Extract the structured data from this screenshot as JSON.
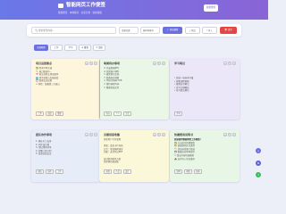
{
  "header": {
    "title": "智能网页工作便签",
    "subtitle": "拖拽便签 · 本地保存 · 标签分类 · 快捷编辑",
    "action_label": "新建便签"
  },
  "toolbar": {
    "search_placeholder": "🔍 搜索便签内容...",
    "category_select": "全部分类",
    "sort_select": "按时间排序",
    "add_label": "＋ 添加便签",
    "export_label": "⤓ 导出",
    "import_label": "⤒ 导入",
    "clear_label": "🗑 清空"
  },
  "tabs": [
    {
      "label": "全部便签",
      "active": true
    },
    {
      "label": "工作",
      "active": false
    },
    {
      "label": "学习",
      "active": false
    },
    {
      "label": "★ 重要",
      "active": false
    },
    {
      "label": "✎ 草稿",
      "active": false
    }
  ],
  "cards": [
    {
      "title": "项目进度要点",
      "color": "#fef6dc",
      "lines": [
        "✅ 需求评审完成",
        "🔧 接口联调中…",
        "📅 周五前提交测试版本",
        "👥 同步前端与后端进度",
        "🗂 整理会议纪要",
        "⚠ 风险：依赖第三方接口"
      ],
      "tags": [
        "工作",
        "进度",
        "重要"
      ]
    },
    {
      "title": "每周待办事项",
      "color": "#eaf6e6",
      "lines": [
        "☑ 完成周报撰写",
        "☑ 回复客户邮件",
        "☐ 更新项目文档",
        "☐ 准备周会材料",
        "☐ 代码评审两个PR",
        "☐ 预约体检时间",
        "☐ 整理桌面文件"
      ],
      "tags": [
        "待办",
        "个人",
        "生活"
      ]
    },
    {
      "title": "学习笔记",
      "color": "#ece7f8",
      "lines": [
        "• 阅读一章技术书籍",
        "• 观看课程视频",
        "• 整理读书笔记",
        "• 复习关键概念",
        "• 练习算法题目"
      ],
      "tags": [
        "学习"
      ]
    },
    {
      "title": "团队协作事项",
      "color": "#e6edf8",
      "lines": [
        "1. 确认分工安排",
        "2. 同步设计稿",
        "3. 测试用例评审",
        "4. 部署上线计划",
        "5. 复盘总结会议"
      ],
      "tags": [
        "团队",
        "协作",
        "工作"
      ]
    },
    {
      "title": "灵感创意收集",
      "color": "#fbf8d9",
      "lines": [
        "优化用户引导流程",
        "",
        "界面：改进卡片布局",
        "交互：增加拖拽排序",
        "功能：支持导出PDF",
        "",
        "尝试新的配色方案",
        "优化移动端适配"
      ],
      "tags": [
        "创意",
        "产品",
        "设计"
      ]
    },
    {
      "title": "快捷使用说明书",
      "color": "#e8f6e6",
      "lines": [
        "欢迎使用智能网页工作便签！",
        "✅ 点击加号新建便签",
        "🎨 选择颜色区分类型",
        "🏷 添加标签便于筛选",
        "💾 数据自动本地保存",
        "✏ 双击内容快速编辑",
        "📤 支持导入导出备份"
      ],
      "tags": [
        "说明",
        "帮助",
        "指南"
      ]
    }
  ],
  "fabs": [
    {
      "icon": "plus-icon",
      "glyph": "+",
      "color": "#6a70e0"
    },
    {
      "icon": "gear-icon",
      "glyph": "⚙",
      "color": "#5b63d6"
    },
    {
      "icon": "help-icon",
      "glyph": "?",
      "color": "#3cbf5a"
    }
  ]
}
